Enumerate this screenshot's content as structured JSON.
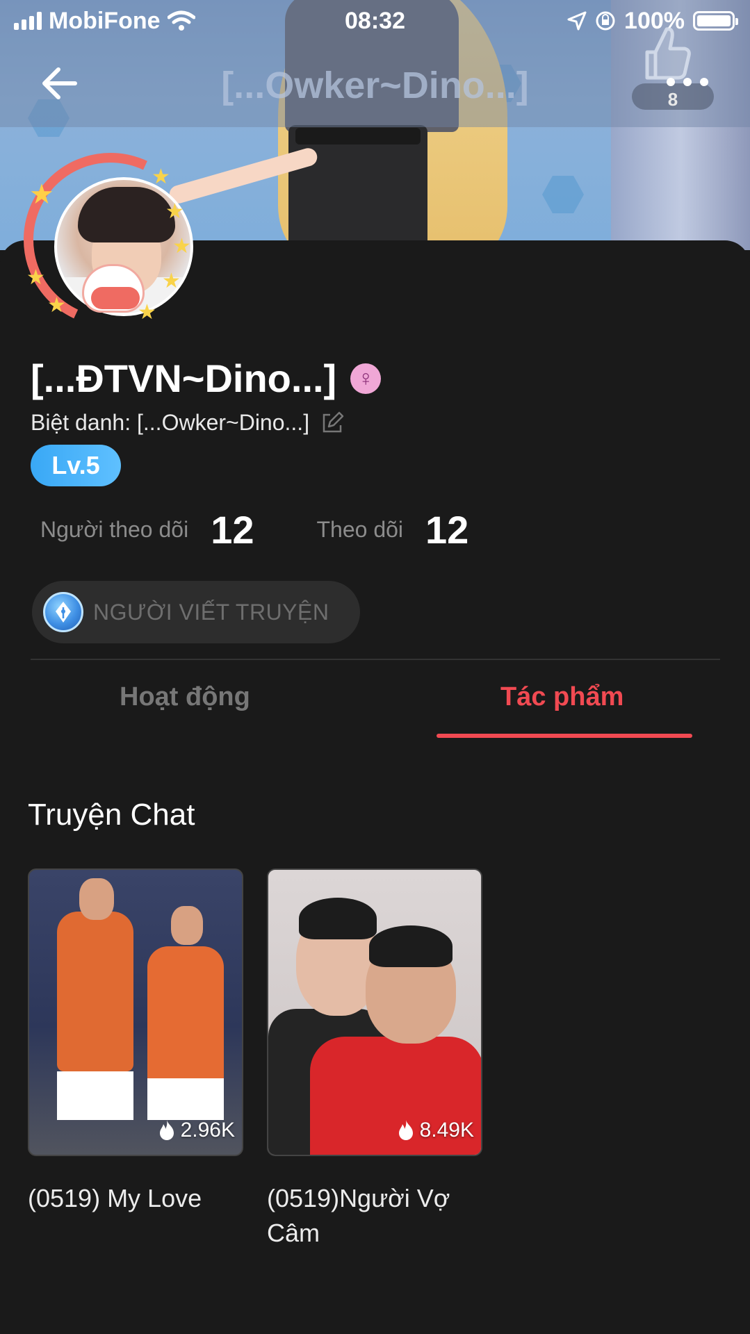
{
  "status_bar": {
    "carrier": "MobiFone",
    "time": "08:32",
    "battery": "100%",
    "battery_level": 1.0
  },
  "header": {
    "title": "[...Owker~Dino...]",
    "like_count": "8",
    "icons": [
      "back-arrow-icon",
      "thumbs-up-icon",
      "more-dots-icon"
    ]
  },
  "profile": {
    "name": "[...ĐTVN~Dino...]",
    "gender_icon": "female-symbol-icon",
    "nickname": "Biệt danh: [...Owker~Dino...]",
    "level": "Lv.5",
    "followers_label": "Người theo dõi",
    "followers_count": "12",
    "following_label": "Theo dõi",
    "following_count": "12",
    "badge": "NGƯỜI VIẾT TRUYỆN"
  },
  "tabs": [
    {
      "label": "Hoạt động",
      "active": false
    },
    {
      "label": "Tác phẩm",
      "active": true
    }
  ],
  "section": {
    "title": "Truyện Chat"
  },
  "stories": [
    {
      "title": "(0519) My Love",
      "views": "2.96K"
    },
    {
      "title": "(0519)Người Vợ Câm",
      "views": "8.49K"
    }
  ],
  "colors": {
    "accent": "#f14a52",
    "level_badge": "#39a8f5",
    "background": "#1a1a1a"
  }
}
